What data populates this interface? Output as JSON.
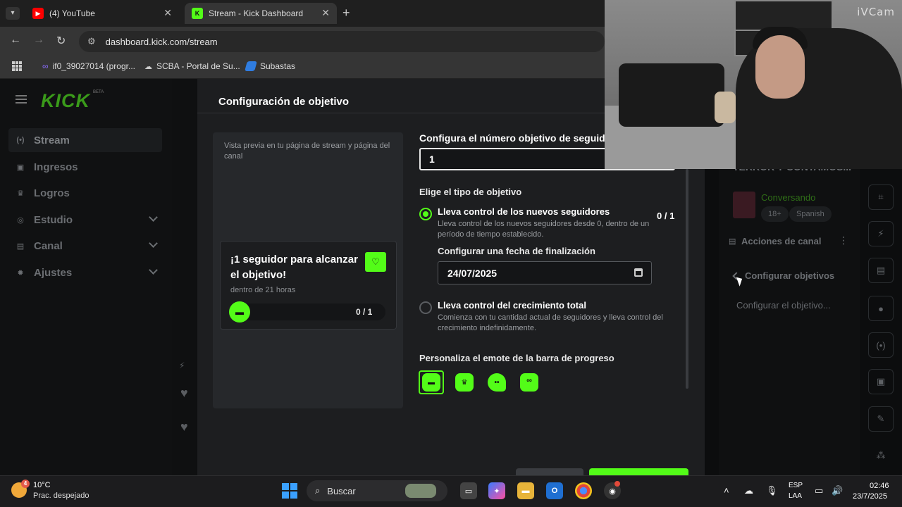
{
  "browser": {
    "tabs": [
      {
        "label": "(4) YouTube",
        "icon": "youtube-icon",
        "active": false
      },
      {
        "label": "Stream - Kick Dashboard",
        "icon": "kick-icon",
        "active": true
      }
    ],
    "url": "dashboard.kick.com/stream",
    "bookmarks": [
      {
        "label": "if0_39027014 (progr..."
      },
      {
        "label": "SCBA - Portal de Su..."
      },
      {
        "label": "Subastas"
      }
    ]
  },
  "sidebar": {
    "brand": "KICK",
    "beta": "BETA",
    "items": [
      {
        "label": "Stream",
        "icon": "stream-icon",
        "active": true,
        "expandable": false
      },
      {
        "label": "Ingresos",
        "icon": "wallet-icon",
        "active": false,
        "expandable": false
      },
      {
        "label": "Logros",
        "icon": "trophy-icon",
        "active": false,
        "expandable": false
      },
      {
        "label": "Estudio",
        "icon": "studio-icon",
        "active": false,
        "expandable": true
      },
      {
        "label": "Canal",
        "icon": "channel-icon",
        "active": false,
        "expandable": true
      },
      {
        "label": "Ajustes",
        "icon": "gear-icon",
        "active": false,
        "expandable": true
      }
    ]
  },
  "modal": {
    "title": "Configuración de objetivo",
    "preview": {
      "caption": "Vista previa en tu página de stream y página del canal",
      "card_title": "¡1 seguidor para alcanzar el objetivo!",
      "card_sub": "dentro de 21 horas",
      "progress_label": "0 / 1",
      "progress": 0
    },
    "target_label": "Configura el número objetivo de seguidores",
    "target_value": "1",
    "type_label": "Elige el tipo de objetivo",
    "options": [
      {
        "title": "Lleva control de los nuevos seguidores",
        "desc": "Lleva control de los nuevos seguidores desde 0, dentro de un período de tiempo establecido.",
        "count": "0 / 1",
        "selected": true
      },
      {
        "title": "Lleva control del crecimiento total",
        "desc": "Comienza con tu cantidad actual de seguidores y lleva control del crecimiento indefinidamente.",
        "selected": false
      }
    ],
    "end_date_label": "Configurar una fecha de finalización",
    "end_date_value": "24/07/2025",
    "emote_label": "Personaliza el emote de la barra de progreso",
    "emotes": [
      "emote-cool",
      "emote-crown",
      "emote-ghost",
      "emote-frog"
    ],
    "selected_emote": 0,
    "accent": "#53fc18"
  },
  "right_panel": {
    "stream_title": "TERROR Y CONTAMOS...",
    "category": "Conversando",
    "tags": [
      "18+",
      "Spanish"
    ],
    "actions_label": "Acciones de canal",
    "goals_label": "Configurar objetivos",
    "goal_config_label": "Configurar el objetivo..."
  },
  "webcam": {
    "brand": "iVCam"
  },
  "taskbar": {
    "weather_temp": "10°C",
    "weather_desc": "Prac. despejado",
    "weather_badge": "4",
    "search_placeholder": "Buscar",
    "lang_1": "ESP",
    "lang_2": "LAA",
    "time": "02:46",
    "date": "23/7/2025"
  }
}
